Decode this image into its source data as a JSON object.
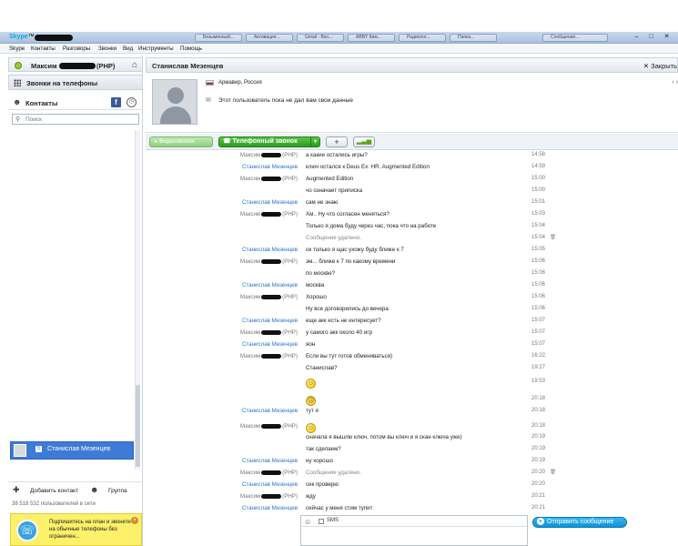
{
  "window": {
    "app_name": "Skype",
    "title_suffix": "™ -",
    "tabs": [
      "Безымянный...",
      "Активация...",
      "Gmail - Вхо...",
      "ABBY Ким...",
      "Радиолог...",
      "Папка...",
      "Сообщения..."
    ],
    "min": "–",
    "max": "□",
    "close": "✕"
  },
  "menu": [
    "Skype",
    "Контакты",
    "Разговоры",
    "Звонки",
    "Вид",
    "Инструменты",
    "Помощь"
  ],
  "profile": {
    "name_prefix": "Максим",
    "name_suffix": "(PHP)",
    "home_icon": "⌂"
  },
  "calls_label": "Звонки на телефоны",
  "contacts": {
    "label": "Контакты",
    "search_placeholder": "Поиск",
    "selected_contact": "Станислав Мезенцев",
    "add_contact": "Добавить контакт",
    "group": "Группа",
    "users_online": "38 518 532 пользователей в сети"
  },
  "promo": {
    "text": "Подпишитесь на план и звоните на обычные телефоны без ограничен...",
    "close": "×"
  },
  "conversation": {
    "title": "Станислав Мезенцев",
    "close_label": "Закрыть",
    "location": "Армавир, Россия",
    "no_data": "Этот пользователь пока не дал вам свои данные",
    "arrows": "‹ ›"
  },
  "callbar": {
    "video": "Видеозвонок",
    "phone_call": "Телефонный звонок",
    "caret": "▾",
    "plus": "+",
    "signal": "▂▃▅"
  },
  "messages": [
    {
      "sender": "me",
      "text": "а какие остались игры?",
      "time": "14:58"
    },
    {
      "sender": "other",
      "text": "ключ остался к Deus Ex: HR. Augmented Edition",
      "time": "14:59"
    },
    {
      "sender": "me",
      "text": "Augmented Edition",
      "time": "15:00"
    },
    {
      "sender": "",
      "text": "чо означает приписка",
      "time": "15:00"
    },
    {
      "sender": "other",
      "text": "сам не знаю",
      "time": "15:01"
    },
    {
      "sender": "me",
      "text": "Хм.. Ну что согласен меняться?",
      "time": "15:03"
    },
    {
      "sender": "",
      "text": "Только я дома буду через час, пока что на работе",
      "time": "15:04"
    },
    {
      "sender": "",
      "text": "Сообщение удалено.",
      "time": "15:04",
      "deleted": true
    },
    {
      "sender": "other",
      "text": "ок только я щас ухожу буду ближе к 7",
      "time": "15:05"
    },
    {
      "sender": "me",
      "text": "эм... ближе к 7 по какому времени",
      "time": "15:06"
    },
    {
      "sender": "",
      "text": "по москве?",
      "time": "15:06"
    },
    {
      "sender": "other",
      "text": "москва",
      "time": "15:06"
    },
    {
      "sender": "me",
      "text": "Хорошо",
      "time": "15:06"
    },
    {
      "sender": "",
      "text": "Ну все договорились до вечера",
      "time": "15:06"
    },
    {
      "sender": "other",
      "text": "еще акк есть не интересует?",
      "time": "15:07"
    },
    {
      "sender": "me",
      "text": "у самого акк около 40 игр",
      "time": "15:07"
    },
    {
      "sender": "other",
      "text": "яон",
      "time": "15:07"
    },
    {
      "sender": "me",
      "text": "Если вы тут готов обмениваться)",
      "time": "16:22"
    },
    {
      "sender": "",
      "text": "Станислав?",
      "time": "19:27"
    }
  ],
  "messages2": [
    {
      "sender": "",
      "text": "",
      "time": "19:53"
    },
    {
      "sender": "",
      "text": "",
      "time": "20:18"
    },
    {
      "sender": "other",
      "text": "тут я",
      "time": "20:18"
    },
    {
      "sender": "me",
      "text": "",
      "time": "20:18"
    },
    {
      "sender": "",
      "text": "сначала я вышлю ключ, потом вы ключ и я скан ключа уже)",
      "time": "20:19"
    },
    {
      "sender": "",
      "text": "так сделаем?",
      "time": "20:19"
    },
    {
      "sender": "other",
      "text": "ну хорошо",
      "time": "20:19"
    },
    {
      "sender": "me",
      "text": "Сообщение удалено.",
      "time": "20:20",
      "deleted": true
    },
    {
      "sender": "other",
      "text": "сек проверю",
      "time": "20:20"
    },
    {
      "sender": "me",
      "text": "жду",
      "time": "20:21"
    },
    {
      "sender": "other",
      "text": "сейчас у меня стим тупит",
      "time": "20:21"
    }
  ],
  "sender_names": {
    "other": "Станислав Мезенцев",
    "me_prefix": "Максим",
    "me_suffix": "(PHP)"
  },
  "trash_icon": "🗑",
  "input": {
    "sms_label": "SMS",
    "emoji": "☺"
  },
  "send_button": "Отправить сообщение",
  "colors": {
    "accent": "#2e73c9",
    "call_green": "#2c9b1e",
    "send_blue": "#0f93d6",
    "promo_yellow": "#fdf06a"
  }
}
